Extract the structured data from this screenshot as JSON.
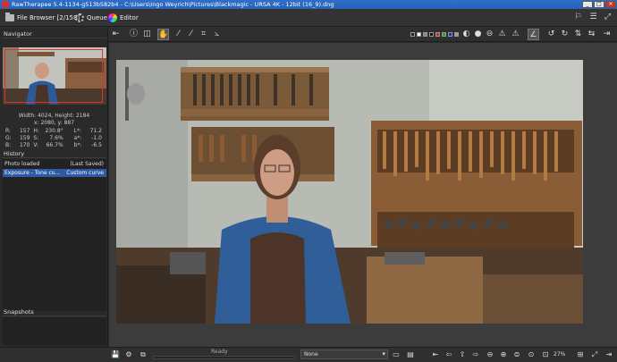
{
  "window": {
    "title": "RawTherapee 5.4-1134-g513b582b4 - C:\\Users\\Ingo Weyrich\\Pictures\\Blackmagic - URSA 4K - 12bit (16_9).dng"
  },
  "tabs": {
    "file_browser": "File Browser [2/158]",
    "queue": "Queue",
    "editor": "Editor"
  },
  "navigator": {
    "header": "Navigator",
    "size": "Width: 4024, Height: 2184",
    "coords": "x: 2080, y: 887",
    "rgb": [
      {
        "c1": "R:",
        "v1": "157",
        "c2": "H:",
        "v2": "230.8°",
        "c3": "L*:",
        "v3": "71.2"
      },
      {
        "c1": "G:",
        "v1": "159",
        "c2": "S:",
        "v2": "7.6%",
        "c3": "a*:",
        "v3": "-1.0"
      },
      {
        "c1": "B:",
        "v1": "170",
        "c2": "V:",
        "v2": "66.7%",
        "c3": "b*:",
        "v3": "-6.5"
      }
    ]
  },
  "history": {
    "header": "History",
    "items": [
      {
        "label": "Photo loaded",
        "value": "(Last Saved)"
      },
      {
        "label": "Exposure - Tone cu...",
        "value": "Custom curve"
      }
    ]
  },
  "snapshots": {
    "header": "Snapshots",
    "add": "+",
    "remove": "−"
  },
  "status": {
    "text": "Ready",
    "progress": 0
  },
  "output_profile": "None",
  "zoom": "27%",
  "colors": {
    "titlebar": "#2563b8",
    "selection": "#2e5aa3",
    "nav_frame": "#dd3333"
  },
  "icons": {
    "titlebar": [
      "app-icon",
      "minimize-icon",
      "maximize-icon",
      "close-icon"
    ],
    "top_right": [
      "flag-icon",
      "fullscreen-icon"
    ],
    "toolbar_left": [
      "hide-panel-icon",
      "info-icon",
      "before-after-icon",
      "hand-icon",
      "color-picker-icon",
      "white-balance-icon",
      "crop-icon",
      "straighten-icon"
    ],
    "toolbar_right": [
      "sharpening-preview-icon",
      "focus-mask-icon",
      "shadow-clip-icon",
      "highlight-clip-icon",
      "gamut-warning-icon",
      "histogram-icon",
      "rotate-left-icon",
      "rotate-right-icon",
      "flip-vertical-icon",
      "flip-horizontal-icon"
    ]
  }
}
